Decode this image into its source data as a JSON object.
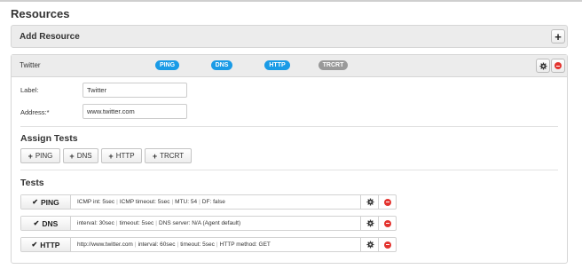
{
  "page": {
    "title": "Resources"
  },
  "add_panel": {
    "title": "Add Resource",
    "add_icon": "plus-icon"
  },
  "resource": {
    "name": "Twitter",
    "badges": [
      {
        "label": "PING",
        "active": true
      },
      {
        "label": "DNS",
        "active": true
      },
      {
        "label": "HTTP",
        "active": true
      },
      {
        "label": "TRCRT",
        "active": false
      }
    ],
    "colors": {
      "badge_active": "#1a9be6",
      "badge_inactive": "#999999",
      "remove": "#e3342f"
    },
    "label_field": {
      "label": "Label:",
      "value": "Twitter"
    },
    "address_field": {
      "label": "Address:*",
      "value": "www.twitter.com"
    },
    "assign_title": "Assign Tests",
    "assign_buttons": [
      {
        "plus": "+",
        "label": "PING"
      },
      {
        "plus": "+",
        "label": "DNS"
      },
      {
        "plus": "+",
        "label": "HTTP"
      },
      {
        "plus": "+",
        "label": "TRCRT"
      }
    ],
    "tests_title": "Tests",
    "tests": [
      {
        "check": "✔",
        "name": "PING",
        "params": [
          "ICMP int: 5sec",
          "ICMP timeout: 5sec",
          "MTU: 54",
          "DF: false"
        ]
      },
      {
        "check": "✔",
        "name": "DNS",
        "params": [
          "interval: 30sec",
          "timeout: 5sec",
          "DNS server: N/A (Agent default)"
        ]
      },
      {
        "check": "✔",
        "name": "HTTP",
        "params": [
          "http://www.twitter.com",
          "interval: 60sec",
          "timeout: 5sec",
          "HTTP method: GET"
        ]
      }
    ]
  }
}
